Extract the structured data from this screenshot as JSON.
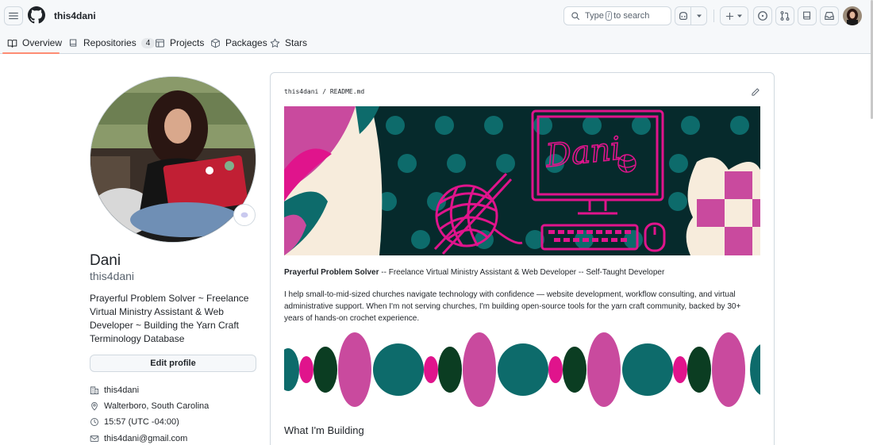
{
  "header": {
    "owner": "this4dani",
    "search_prefix": "Type",
    "search_key": "/",
    "search_suffix": "to search"
  },
  "tabs": [
    {
      "label": "Overview",
      "icon": "book-icon",
      "selected": true
    },
    {
      "label": "Repositories",
      "icon": "repo-icon",
      "count": "4"
    },
    {
      "label": "Projects",
      "icon": "table-icon"
    },
    {
      "label": "Packages",
      "icon": "package-icon"
    },
    {
      "label": "Stars",
      "icon": "star-icon"
    }
  ],
  "profile": {
    "name": "Dani",
    "username": "this4dani",
    "bio": "Prayerful Problem Solver ~ Freelance Virtual Ministry Assistant & Web Developer ~ Building the Yarn Craft Terminology Database",
    "edit_label": "Edit profile",
    "details": [
      {
        "icon": "organization-icon",
        "text": "this4dani"
      },
      {
        "icon": "location-icon",
        "text": "Walterboro, South Carolina"
      },
      {
        "icon": "clock-icon",
        "text": "15:57 (UTC -04:00)"
      },
      {
        "icon": "mail-icon",
        "text": "this4dani@gmail.com"
      }
    ]
  },
  "readme": {
    "path_owner": "this4dani",
    "path_sep": "/",
    "path_file": "README.md",
    "banner_text": "Dani",
    "tagline_bold": "Prayerful Problem Solver",
    "tagline_rest": " -- Freelance Virtual Ministry Assistant & Web Developer -- Self-Taught Developer",
    "intro": "I help small-to-mid-sized churches navigate technology with confidence — website development, workflow consulting, and virtual administrative support. When I'm not serving churches, I'm building open-source tools for the yarn craft community, backed by 30+ years of hands-on crochet experience.",
    "section_heading": "What I'm Building"
  },
  "colors": {
    "accent_underline": "#fd8c73",
    "banner_bg": "#062a2c",
    "teal": "#0d6b6b",
    "pink": "#e0148c",
    "magenta": "#c94a9e",
    "cream": "#f7ecdc",
    "dark_green": "#0b3d22"
  }
}
